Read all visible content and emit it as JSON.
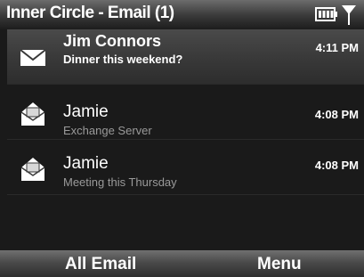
{
  "titlebar": {
    "title": "Inner Circle - Email (1)",
    "icons": [
      "battery-icon",
      "signal-icon"
    ]
  },
  "messages": [
    {
      "sender": "Jim Connors",
      "subject": "Dinner this weekend?",
      "time": "4:11 PM",
      "unread": true,
      "selected": true,
      "icon": "envelope-closed-icon"
    },
    {
      "sender": "Jamie",
      "subject": "Exchange Server",
      "time": "4:08 PM",
      "unread": false,
      "selected": false,
      "icon": "envelope-open-icon"
    },
    {
      "sender": "Jamie",
      "subject": "Meeting this Thursday",
      "time": "4:08 PM",
      "unread": false,
      "selected": false,
      "icon": "envelope-open-icon"
    }
  ],
  "softkeys": {
    "left": "All Email",
    "right": "Menu"
  },
  "colors": {
    "background": "#1a1a1a",
    "text": "#ffffff",
    "subject_read": "#9a9a9a"
  }
}
